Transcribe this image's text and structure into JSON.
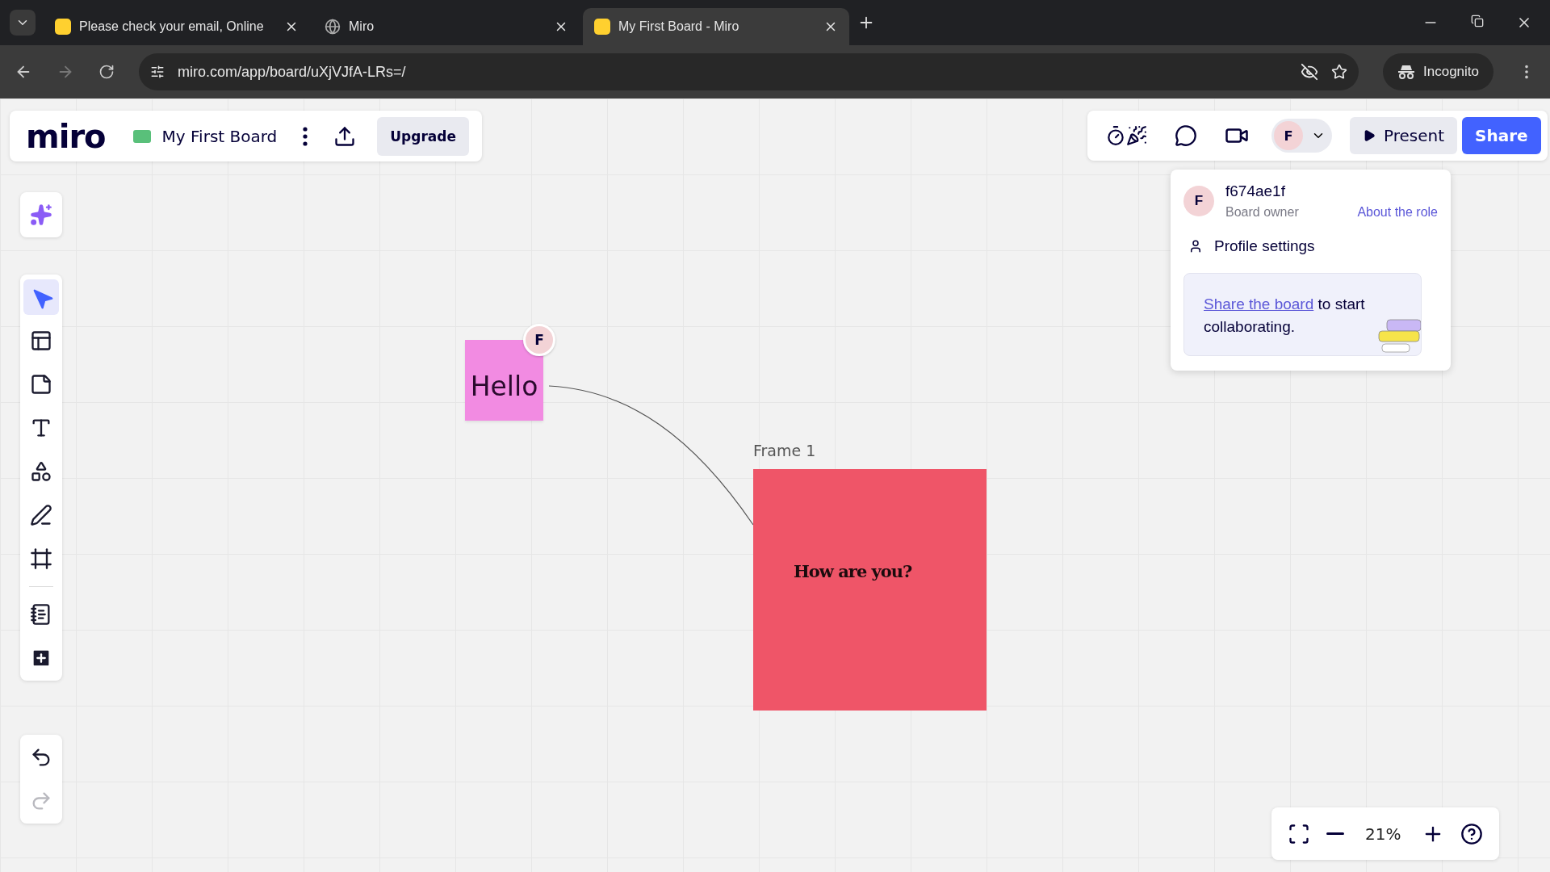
{
  "browser": {
    "tabs": [
      {
        "title": "Please check your email, Online",
        "kind": "miro",
        "selected": false
      },
      {
        "title": "Miro",
        "kind": "globe",
        "selected": false
      },
      {
        "title": "My First Board - Miro",
        "kind": "miro",
        "selected": true
      }
    ],
    "url": "miro.com/app/board/uXjVJfA-LRs=/",
    "incognito": "Incognito"
  },
  "board": {
    "logo": "miro",
    "title": "My First Board",
    "upgrade": "Upgrade",
    "avatar": "F",
    "present": "Present",
    "share": "Share"
  },
  "menu": {
    "avatar": "F",
    "user": "f674ae1f",
    "role": "Board owner",
    "role_link": "About the role",
    "profile": "Profile settings",
    "promo_link": "Share the board",
    "promo_text": " to start collaborating."
  },
  "tools": [
    {
      "kind": "ai",
      "selected": false,
      "disabled": false
    },
    {
      "kind": "select",
      "selected": true,
      "disabled": false
    },
    {
      "kind": "templates",
      "selected": false,
      "disabled": false
    },
    {
      "kind": "sticky",
      "selected": false,
      "disabled": false
    },
    {
      "kind": "text",
      "selected": false,
      "disabled": false
    },
    {
      "kind": "shapes",
      "selected": false,
      "disabled": false
    },
    {
      "kind": "pen",
      "selected": false,
      "disabled": false
    },
    {
      "kind": "frame",
      "selected": false,
      "disabled": false
    },
    {
      "kind": "notes",
      "selected": false,
      "disabled": false
    },
    {
      "kind": "add",
      "selected": false,
      "disabled": false
    },
    {
      "kind": "undo",
      "selected": false,
      "disabled": false
    },
    {
      "kind": "redo",
      "selected": false,
      "disabled": true
    }
  ],
  "canvas": {
    "sticky": {
      "text": "Hello",
      "avatar": "F",
      "color": "#f28be2"
    },
    "frame": {
      "title": "Frame 1",
      "text": "How are you?",
      "color": "#ef5568"
    }
  },
  "zoom": {
    "level_text": "21%"
  }
}
